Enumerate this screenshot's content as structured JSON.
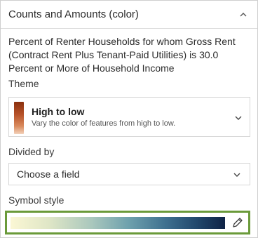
{
  "header": {
    "title": "Counts and Amounts (color)"
  },
  "description": "Percent of Renter Households for whom Gross Rent (Contract Rent Plus Tenant-Paid Utilities) is 30.0 Percent or More of Household Income",
  "theme": {
    "label": "Theme",
    "name": "High to low",
    "description": "Vary the color of features from high to low."
  },
  "divided_by": {
    "label": "Divided by",
    "value": "Choose a field"
  },
  "symbol_style": {
    "label": "Symbol style"
  },
  "icons": {
    "header_toggle": "chevron-up-icon",
    "theme_dropdown": "chevron-down-icon",
    "field_dropdown": "chevron-down-icon",
    "edit_symbol": "pencil-icon"
  },
  "colors": {
    "highlight_border": "#6a9a3a",
    "theme_ramp": [
      "#8a2f0d",
      "#f3d2bb"
    ],
    "symbol_ramp": [
      "#fbf7d4",
      "#6ea1ad",
      "#0f2346"
    ]
  }
}
